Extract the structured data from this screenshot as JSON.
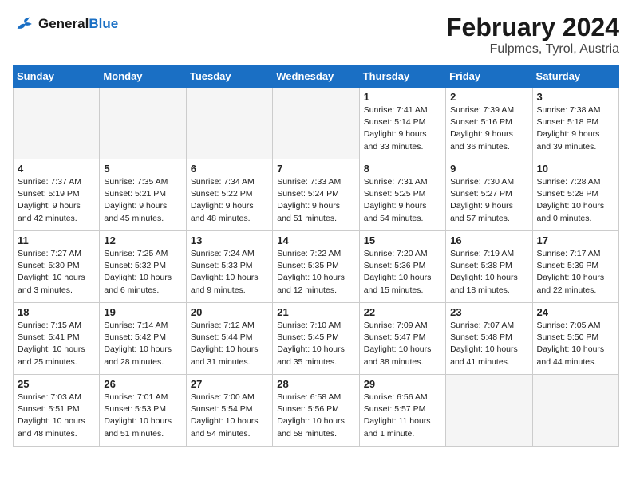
{
  "logo": {
    "text_general": "General",
    "text_blue": "Blue"
  },
  "title": "February 2024",
  "location": "Fulpmes, Tyrol, Austria",
  "weekdays": [
    "Sunday",
    "Monday",
    "Tuesday",
    "Wednesday",
    "Thursday",
    "Friday",
    "Saturday"
  ],
  "weeks": [
    [
      {
        "day": "",
        "empty": true
      },
      {
        "day": "",
        "empty": true
      },
      {
        "day": "",
        "empty": true
      },
      {
        "day": "",
        "empty": true
      },
      {
        "day": "1",
        "sunrise": "7:41 AM",
        "sunset": "5:14 PM",
        "daylight": "9 hours and 33 minutes."
      },
      {
        "day": "2",
        "sunrise": "7:39 AM",
        "sunset": "5:16 PM",
        "daylight": "9 hours and 36 minutes."
      },
      {
        "day": "3",
        "sunrise": "7:38 AM",
        "sunset": "5:18 PM",
        "daylight": "9 hours and 39 minutes."
      }
    ],
    [
      {
        "day": "4",
        "sunrise": "7:37 AM",
        "sunset": "5:19 PM",
        "daylight": "9 hours and 42 minutes."
      },
      {
        "day": "5",
        "sunrise": "7:35 AM",
        "sunset": "5:21 PM",
        "daylight": "9 hours and 45 minutes."
      },
      {
        "day": "6",
        "sunrise": "7:34 AM",
        "sunset": "5:22 PM",
        "daylight": "9 hours and 48 minutes."
      },
      {
        "day": "7",
        "sunrise": "7:33 AM",
        "sunset": "5:24 PM",
        "daylight": "9 hours and 51 minutes."
      },
      {
        "day": "8",
        "sunrise": "7:31 AM",
        "sunset": "5:25 PM",
        "daylight": "9 hours and 54 minutes."
      },
      {
        "day": "9",
        "sunrise": "7:30 AM",
        "sunset": "5:27 PM",
        "daylight": "9 hours and 57 minutes."
      },
      {
        "day": "10",
        "sunrise": "7:28 AM",
        "sunset": "5:28 PM",
        "daylight": "10 hours and 0 minutes."
      }
    ],
    [
      {
        "day": "11",
        "sunrise": "7:27 AM",
        "sunset": "5:30 PM",
        "daylight": "10 hours and 3 minutes."
      },
      {
        "day": "12",
        "sunrise": "7:25 AM",
        "sunset": "5:32 PM",
        "daylight": "10 hours and 6 minutes."
      },
      {
        "day": "13",
        "sunrise": "7:24 AM",
        "sunset": "5:33 PM",
        "daylight": "10 hours and 9 minutes."
      },
      {
        "day": "14",
        "sunrise": "7:22 AM",
        "sunset": "5:35 PM",
        "daylight": "10 hours and 12 minutes."
      },
      {
        "day": "15",
        "sunrise": "7:20 AM",
        "sunset": "5:36 PM",
        "daylight": "10 hours and 15 minutes."
      },
      {
        "day": "16",
        "sunrise": "7:19 AM",
        "sunset": "5:38 PM",
        "daylight": "10 hours and 18 minutes."
      },
      {
        "day": "17",
        "sunrise": "7:17 AM",
        "sunset": "5:39 PM",
        "daylight": "10 hours and 22 minutes."
      }
    ],
    [
      {
        "day": "18",
        "sunrise": "7:15 AM",
        "sunset": "5:41 PM",
        "daylight": "10 hours and 25 minutes."
      },
      {
        "day": "19",
        "sunrise": "7:14 AM",
        "sunset": "5:42 PM",
        "daylight": "10 hours and 28 minutes."
      },
      {
        "day": "20",
        "sunrise": "7:12 AM",
        "sunset": "5:44 PM",
        "daylight": "10 hours and 31 minutes."
      },
      {
        "day": "21",
        "sunrise": "7:10 AM",
        "sunset": "5:45 PM",
        "daylight": "10 hours and 35 minutes."
      },
      {
        "day": "22",
        "sunrise": "7:09 AM",
        "sunset": "5:47 PM",
        "daylight": "10 hours and 38 minutes."
      },
      {
        "day": "23",
        "sunrise": "7:07 AM",
        "sunset": "5:48 PM",
        "daylight": "10 hours and 41 minutes."
      },
      {
        "day": "24",
        "sunrise": "7:05 AM",
        "sunset": "5:50 PM",
        "daylight": "10 hours and 44 minutes."
      }
    ],
    [
      {
        "day": "25",
        "sunrise": "7:03 AM",
        "sunset": "5:51 PM",
        "daylight": "10 hours and 48 minutes."
      },
      {
        "day": "26",
        "sunrise": "7:01 AM",
        "sunset": "5:53 PM",
        "daylight": "10 hours and 51 minutes."
      },
      {
        "day": "27",
        "sunrise": "7:00 AM",
        "sunset": "5:54 PM",
        "daylight": "10 hours and 54 minutes."
      },
      {
        "day": "28",
        "sunrise": "6:58 AM",
        "sunset": "5:56 PM",
        "daylight": "10 hours and 58 minutes."
      },
      {
        "day": "29",
        "sunrise": "6:56 AM",
        "sunset": "5:57 PM",
        "daylight": "11 hours and 1 minute."
      },
      {
        "day": "",
        "empty": true
      },
      {
        "day": "",
        "empty": true
      }
    ]
  ],
  "labels": {
    "sunrise": "Sunrise:",
    "sunset": "Sunset:",
    "daylight": "Daylight hours"
  }
}
